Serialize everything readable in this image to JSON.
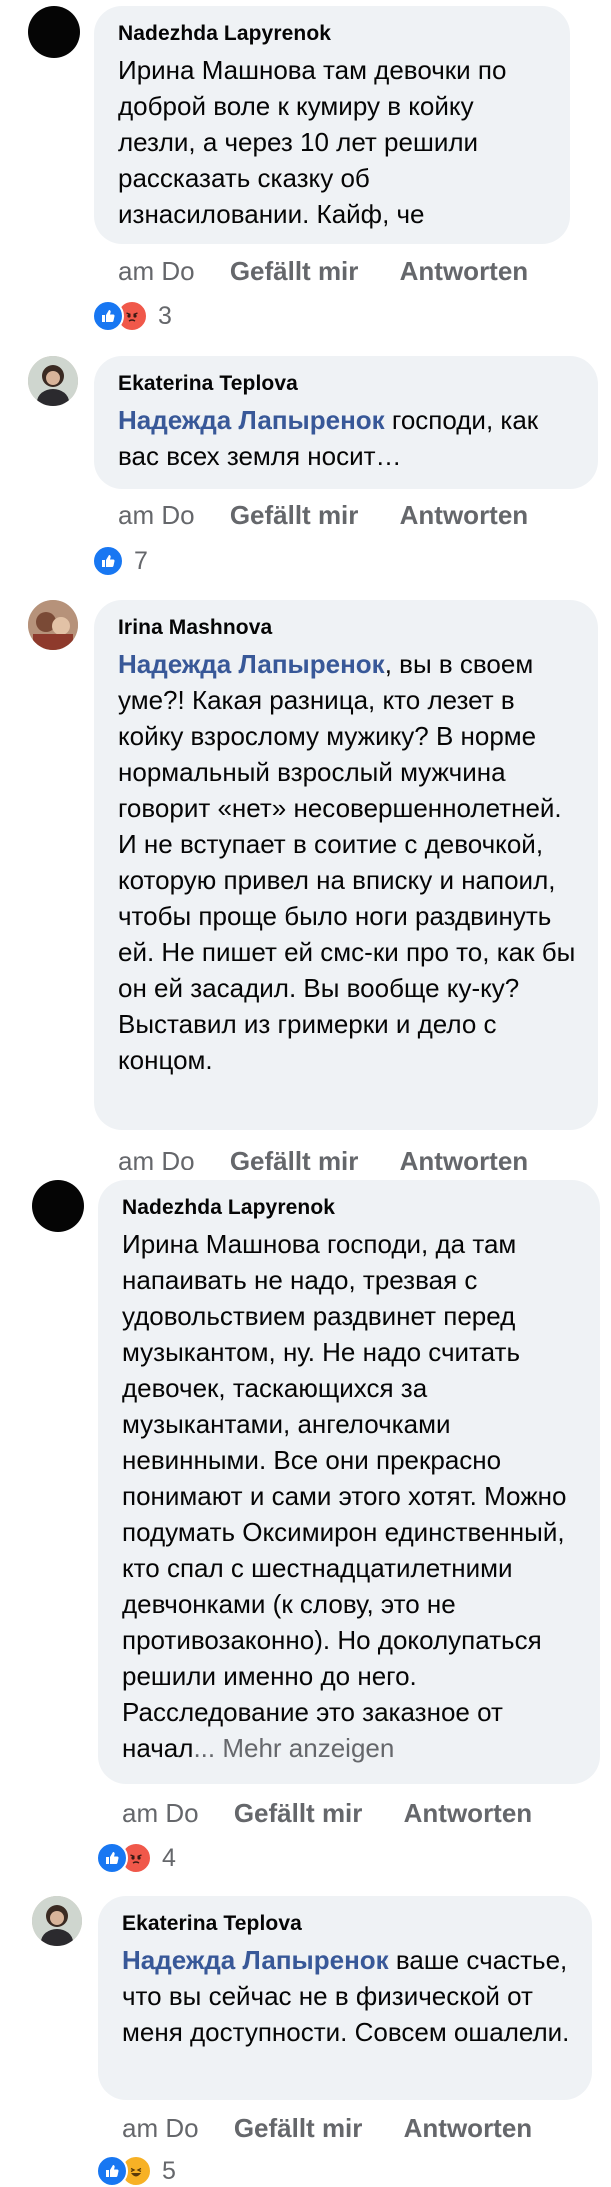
{
  "comments": [
    {
      "author": "Nadezhda Lapyrenok",
      "text": "Ирина Машнова там девочки по доброй воле к кумиру в койку лезли, а через 10 лет решили рассказать сказку об изнасиловании. Кайф, че",
      "time": "am Do",
      "like_label": "Gefällt mir",
      "reply_label": "Antworten",
      "reaction_count": "3",
      "reactions": [
        "like-icon",
        "angry-icon"
      ]
    },
    {
      "author": "Ekaterina Teplova",
      "mention": "Надежда Лапыренок",
      "text": " господи, как вас всех земля носит…",
      "time": "am Do",
      "like_label": "Gefällt mir",
      "reply_label": "Antworten",
      "reaction_count": "7",
      "reactions": [
        "like-icon"
      ]
    },
    {
      "author": "Irina  Mashnova",
      "mention": "Надежда Лапыренок",
      "text": ", вы в своем уме?! Какая разница, кто лезет в койку взрослому мужику? В норме нормальный взрослый мужчина говорит «нет» несовершеннолетней. И не вступает в соитие с девочкой, которую привел на вписку и напоил, чтобы проще было ноги раздвинуть ей. Не пишет ей смс-ки про то, как бы он ей засадил. Вы вообще ку-ку? Выставил из гримерки и дело с концом.",
      "time": "am Do",
      "like_label": "Gefällt mir",
      "reply_label": "Antworten"
    },
    {
      "author": "Nadezhda Lapyrenok",
      "text": "Ирина Машнова господи, да там напаивать не надо, трезвая с удовольствием раздвинет перед музыкантом, ну. Не надо считать девочек, таскающихся за музыкантами, ангелочками невинными. Все они прекрасно понимают и сами этого хотят. Можно подумать Оксимирон единственный, кто спал с шестнадцатилетними девчонками (к слову, это не противозаконно). Но доколупаться решили именно до него. Расследование это заказное от начал",
      "more_label": "... Mehr anzeigen",
      "time": "am Do",
      "like_label": "Gefällt mir",
      "reply_label": "Antworten",
      "reaction_count": "4",
      "reactions": [
        "like-icon",
        "angry-icon"
      ]
    },
    {
      "author": "Ekaterina Teplova",
      "mention": "Надежда Лапыренок",
      "text": " ваше счастье, что вы сейчас не в физической от меня доступности. Совсем ошалели.",
      "time": "am Do",
      "like_label": "Gefällt mir",
      "reply_label": "Antworten",
      "reaction_count": "5",
      "reactions": [
        "like-icon",
        "haha-icon"
      ]
    }
  ],
  "colors": {
    "bubble": "#eff2f5",
    "mention": "#385898",
    "meta": "#65676b",
    "like": "#1877f2",
    "angry": "#f0584a",
    "haha": "#f7b125"
  }
}
